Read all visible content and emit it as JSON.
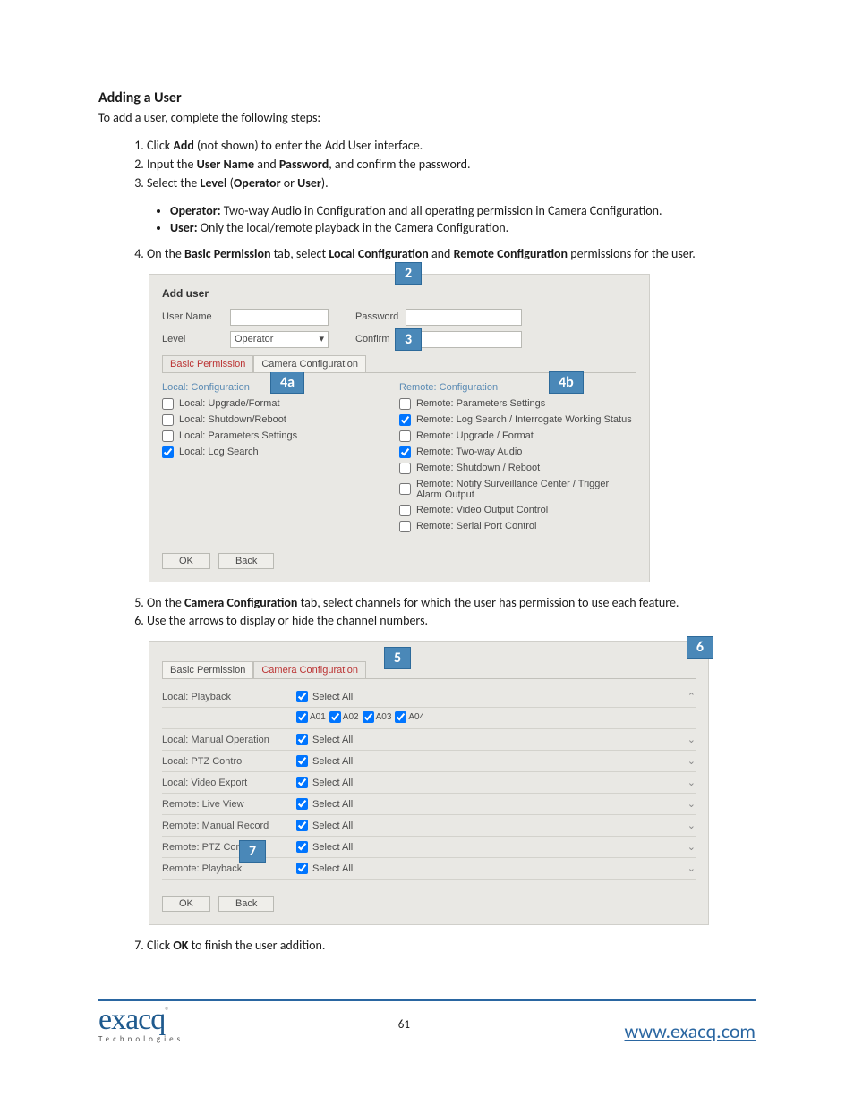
{
  "heading": "Adding a User",
  "intro": "To add a user, complete the following steps:",
  "steps": {
    "s1_prefix": "Click ",
    "s1_bold": "Add",
    "s1_suffix": " (not shown) to enter the Add User interface.",
    "s2_prefix": "Input the ",
    "s2_bold1": "User Name",
    "s2_mid": " and ",
    "s2_bold2": "Password",
    "s2_suffix": ", and confirm the password.",
    "s3_prefix": "Select the ",
    "s3_bold1": "Level",
    "s3_paren_open": " (",
    "s3_bold2": "Operator",
    "s3_or": " or ",
    "s3_bold3": "User",
    "s3_paren_close": ").",
    "s4_prefix": "On the ",
    "s4_bold1": "Basic Permission",
    "s4_mid1": " tab, select ",
    "s4_bold2": "Local Configuration",
    "s4_mid2": " and ",
    "s4_bold3": "Remote Configuration",
    "s4_suffix": " permissions for the user.",
    "s5_prefix": "On the ",
    "s5_bold1": "Camera Configuration",
    "s5_suffix": " tab, select channels for which the user has permission to use each feature.",
    "s6": "Use the arrows to display or hide the channel numbers.",
    "s7_prefix": "Click ",
    "s7_bold": "OK",
    "s7_suffix": " to finish the user addition."
  },
  "sublist": {
    "op_bold": "Operator:",
    "op_text": " Two-way Audio in Configuration and all operating permission in Camera Configuration.",
    "user_bold": "User:",
    "user_text": " Only the local/remote playback in the Camera Configuration."
  },
  "shot1": {
    "title": "Add user",
    "username_lbl": "User Name",
    "password_lbl": "Password",
    "level_lbl": "Level",
    "level_val": "Operator",
    "confirm_lbl": "Confirm",
    "tab_basic": "Basic Permission",
    "tab_camera": "Camera Configuration",
    "local_head": "Local: Configuration",
    "local_items": [
      "Local: Upgrade/Format",
      "Local: Shutdown/Reboot",
      "Local: Parameters Settings",
      "Local: Log Search"
    ],
    "remote_head": "Remote: Configuration",
    "remote_items": [
      "Remote: Parameters Settings",
      "Remote: Log Search / Interrogate Working Status",
      "Remote: Upgrade / Format",
      "Remote: Two-way Audio",
      "Remote: Shutdown / Reboot",
      "Remote: Notify Surveillance Center / Trigger Alarm Output",
      "Remote: Video Output Control",
      "Remote: Serial Port Control"
    ],
    "ok": "OK",
    "back": "Back",
    "callouts": {
      "c2": "2",
      "c3": "3",
      "c4a": "4a",
      "c4b": "4b"
    }
  },
  "shot2": {
    "tab_basic": "Basic Permission",
    "tab_camera": "Camera Configuration",
    "rows": [
      "Local: Playback",
      "Local: Manual Operation",
      "Local: PTZ Control",
      "Local: Video Export",
      "Remote: Live View",
      "Remote: Manual Record",
      "Remote: PTZ Control",
      "Remote: Playback"
    ],
    "select_all": "Select All",
    "channels": [
      "A01",
      "A02",
      "A03",
      "A04"
    ],
    "ok": "OK",
    "back": "Back",
    "callouts": {
      "c5": "5",
      "c6": "6",
      "c7": "7"
    }
  },
  "footer": {
    "logo_main": "exacq",
    "logo_reg": "®",
    "logo_sub": "Technologies",
    "page": "61",
    "url": "www.exacq.com"
  }
}
